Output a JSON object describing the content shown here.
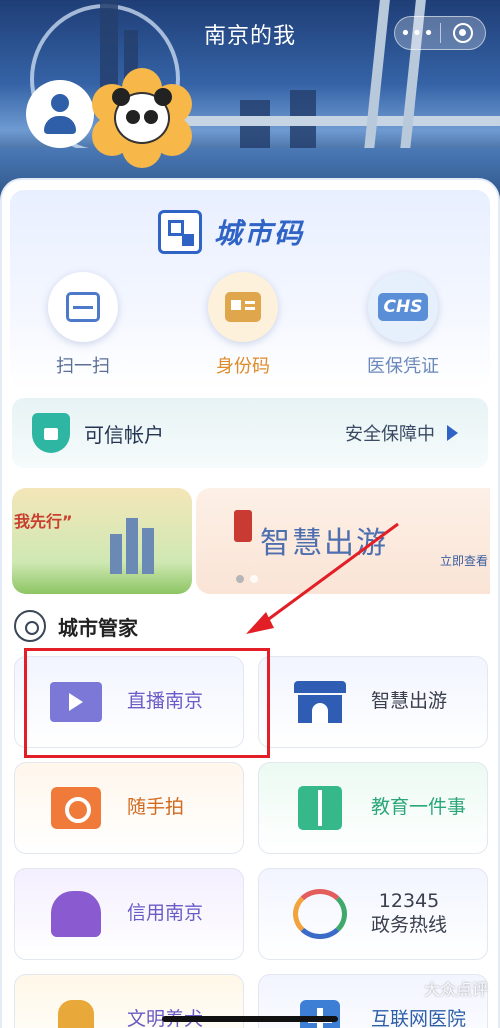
{
  "header": {
    "title": "南京的我"
  },
  "capsule": {
    "more_icon": "more-dots-icon",
    "close_icon": "close-circle-icon"
  },
  "city_code": {
    "title": "城市码"
  },
  "quick_actions": [
    {
      "label": "扫一扫",
      "icon": "scan-icon",
      "color": "#5b6f96"
    },
    {
      "label": "身份码",
      "icon": "id-card-icon",
      "color": "#e08a2a"
    },
    {
      "label": "医保凭证",
      "icon": "chs-icon",
      "badge": "CHS",
      "color": "#6a88b9"
    }
  ],
  "trusted_account": {
    "label": "可信帐户",
    "status": "安全保障中"
  },
  "banners": {
    "left": {
      "slogan": "我先行”"
    },
    "right": {
      "title": "智慧出游",
      "seal": "金陵",
      "more": "立即查看"
    }
  },
  "section": {
    "title": "城市管家"
  },
  "services": [
    {
      "label": "直播南京",
      "icon": "video-camera-icon"
    },
    {
      "label": "智慧出游",
      "icon": "city-gate-icon"
    },
    {
      "label": "随手拍",
      "icon": "camera-icon"
    },
    {
      "label": "教育一件事",
      "icon": "book-icon"
    },
    {
      "label": "信用南京",
      "icon": "lion-icon"
    },
    {
      "label_line1": "12345",
      "label_line2": "政务热线",
      "icon": "hotline-icon"
    },
    {
      "label": "文明养犬",
      "icon": "dog-icon"
    },
    {
      "label": "互联网医院",
      "icon": "hospital-cross-icon"
    }
  ],
  "watermark": "大众点评",
  "colors": {
    "accent": "#2f63c6",
    "annotation_red": "#e21f26"
  }
}
